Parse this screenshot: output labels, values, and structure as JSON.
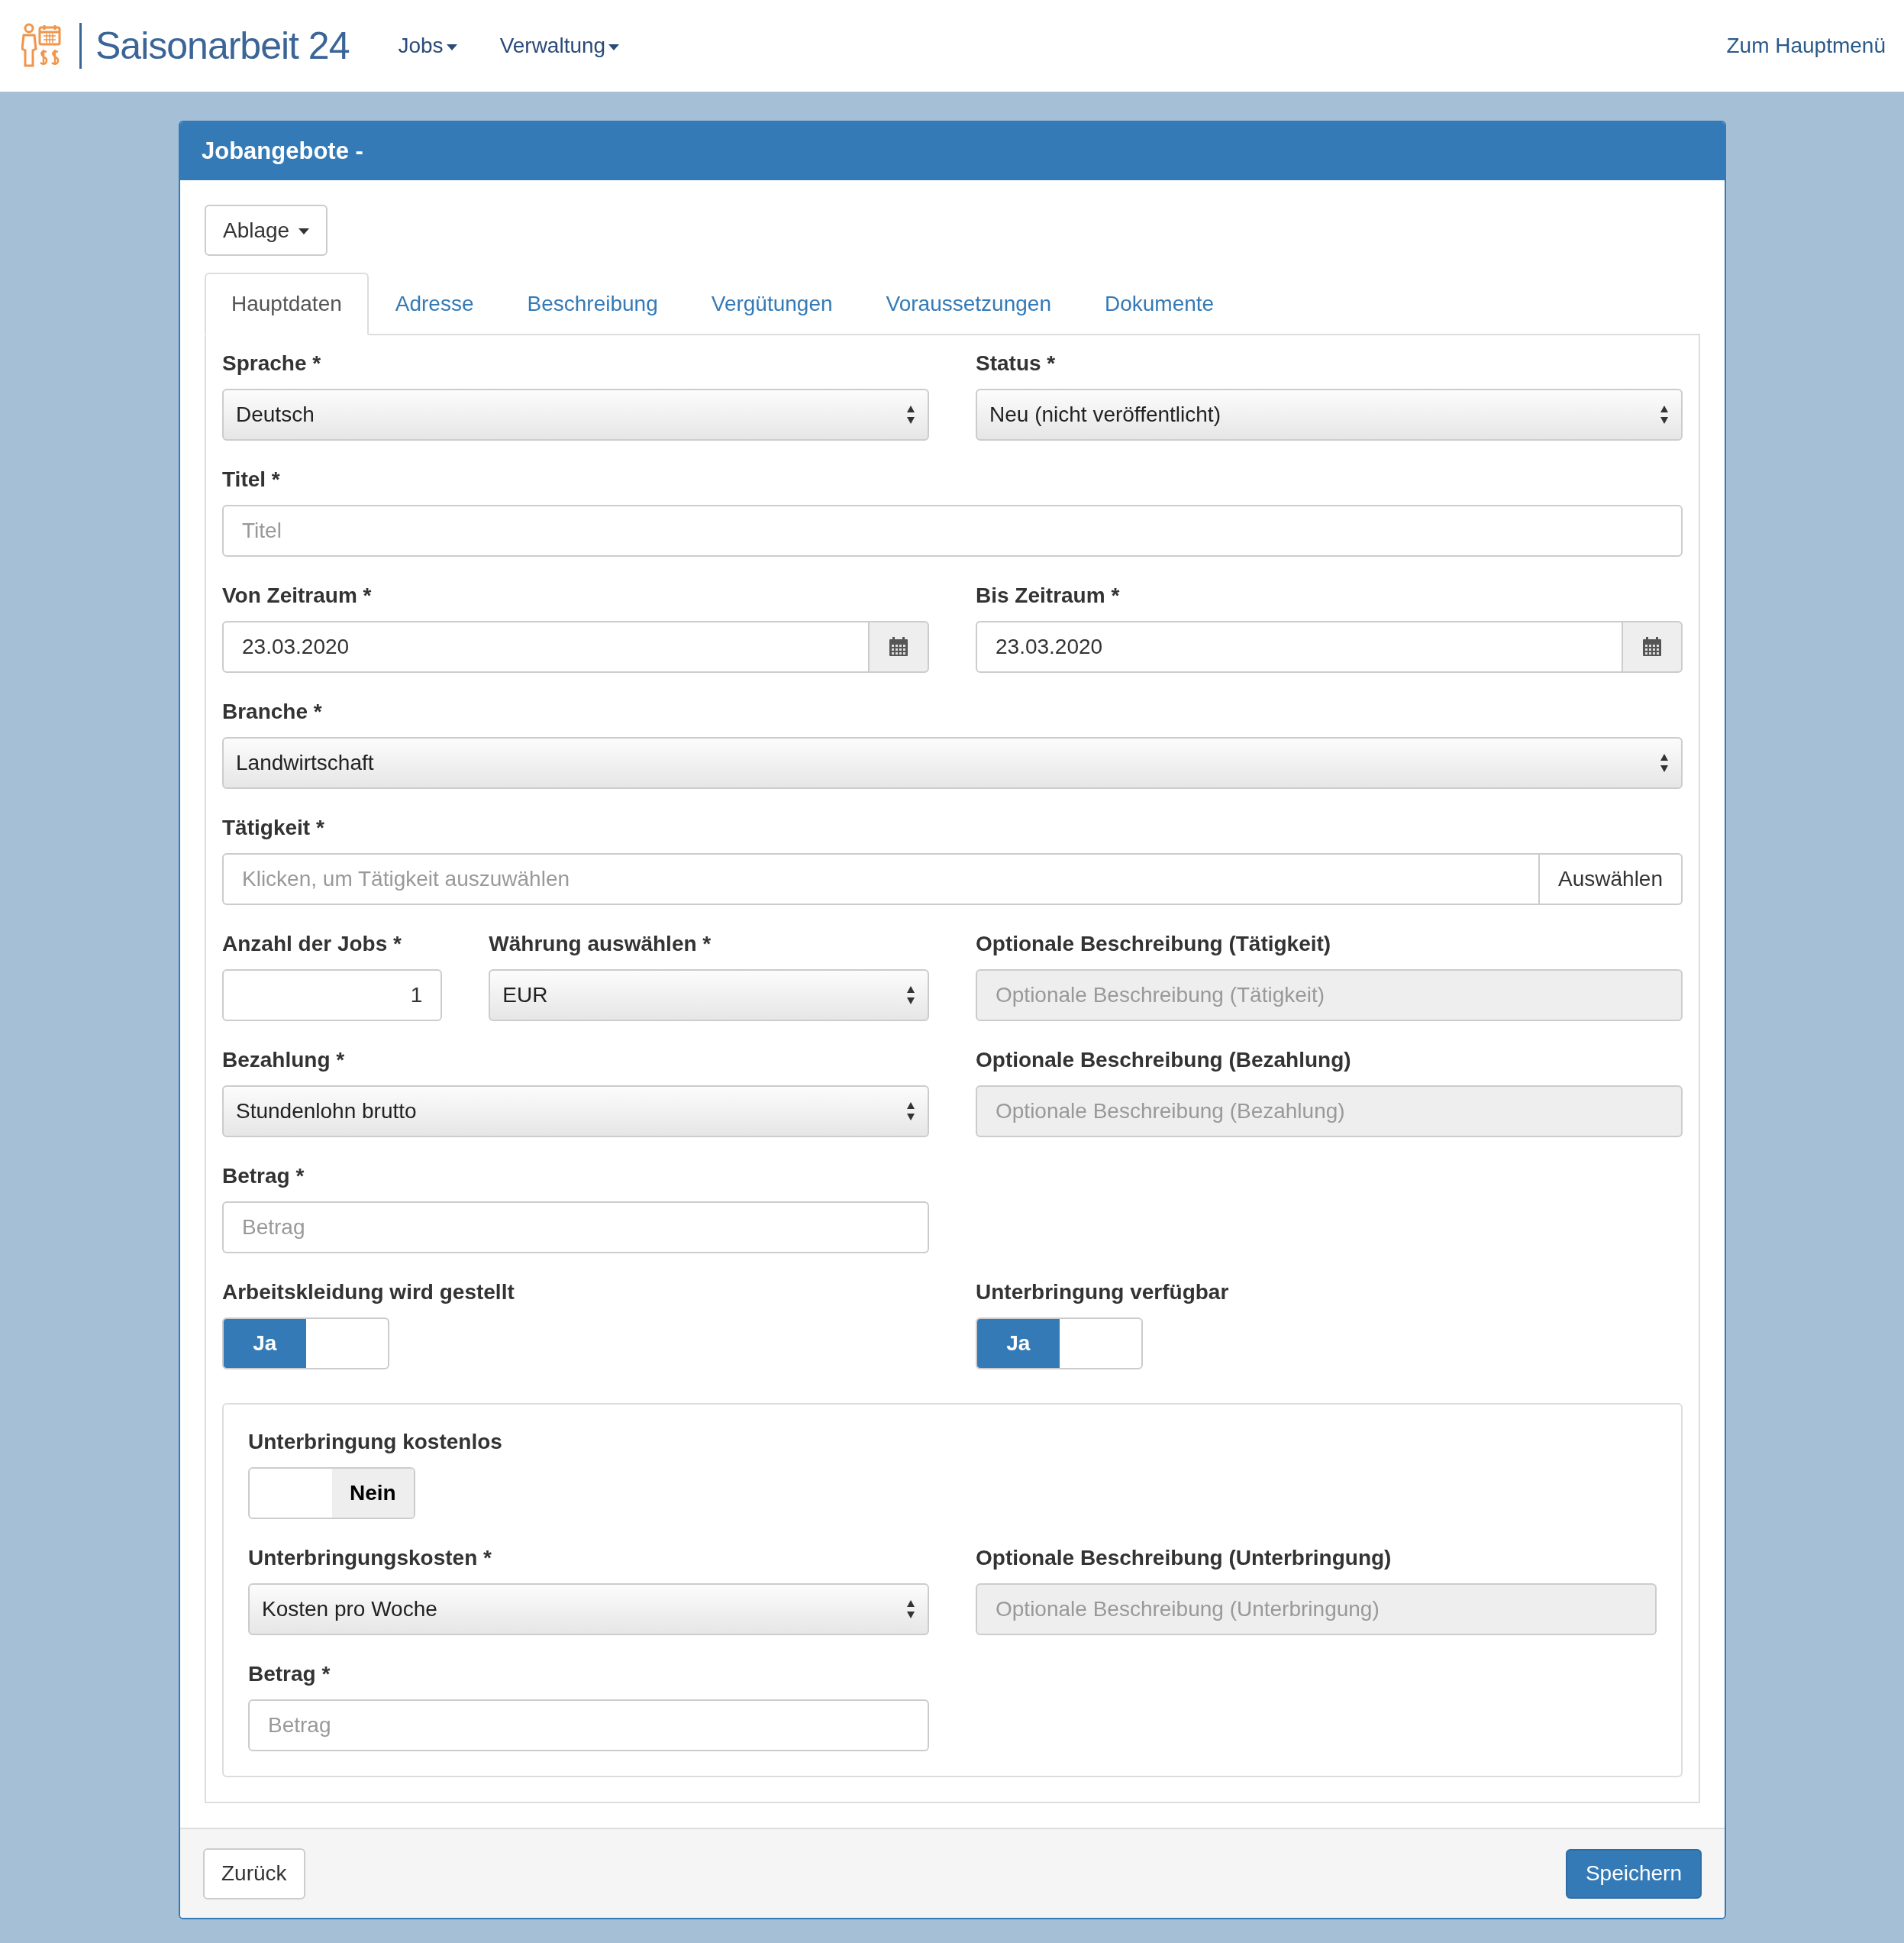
{
  "brand": {
    "name": "Saisonarbeit 24"
  },
  "nav": [
    {
      "label": "Jobs"
    },
    {
      "label": "Verwaltung"
    }
  ],
  "nav_right": "Zum Hauptmenü",
  "panel_title": "Jobangebote -",
  "file_menu": "Ablage",
  "tabs": [
    {
      "label": "Hauptdaten",
      "selected": true
    },
    {
      "label": "Adresse",
      "selected": false
    },
    {
      "label": "Beschreibung",
      "selected": false
    },
    {
      "label": "Vergütungen",
      "selected": false
    },
    {
      "label": "Voraussetzungen",
      "selected": false
    },
    {
      "label": "Dokumente",
      "selected": false
    }
  ],
  "rows": [
    {
      "kind": "fields",
      "fields": [
        {
          "kind": "select",
          "label": "Sprache *",
          "value": "Deutsch"
        },
        {
          "kind": "select",
          "label": "Status *",
          "value": "Neu (nicht veröffentlicht)"
        }
      ]
    },
    {
      "kind": "fields",
      "fields": [
        {
          "kind": "text",
          "label": "Titel *",
          "placeholder": "Titel",
          "disabled": false,
          "wide": true
        }
      ]
    },
    {
      "kind": "fields",
      "fields": [
        {
          "kind": "date",
          "label": "Von Zeitraum *",
          "value": "23.03.2020"
        },
        {
          "kind": "date",
          "label": "Bis Zeitraum *",
          "value": "23.03.2020"
        }
      ]
    },
    {
      "kind": "fields",
      "fields": [
        {
          "kind": "select",
          "label": "Branche *",
          "value": "Landwirtschaft",
          "wide": true
        }
      ]
    },
    {
      "kind": "fields",
      "fields": [
        {
          "kind": "picker",
          "label": "Tätigkeit *",
          "placeholder": "Klicken, um Tätigkeit auszuwählen",
          "button": "Auswählen",
          "wide": true
        }
      ]
    },
    {
      "kind": "fields",
      "fields": [
        {
          "kind": "number",
          "label": "Anzahl der Jobs *",
          "value": "1"
        },
        {
          "kind": "select",
          "label": "Währung auswählen *",
          "value": "EUR"
        },
        {
          "kind": "text",
          "label": "Optionale Beschreibung (Tätigkeit)",
          "placeholder": "Optionale Beschreibung (Tätigkeit)",
          "disabled": true
        }
      ]
    },
    {
      "kind": "fields",
      "fields": [
        {
          "kind": "select",
          "label": "Bezahlung *",
          "value": "Stundenlohn brutto"
        },
        {
          "kind": "text",
          "label": "Optionale Beschreibung (Bezahlung)",
          "placeholder": "Optionale Beschreibung (Bezahlung)",
          "disabled": true
        }
      ]
    },
    {
      "kind": "fields",
      "fields": [
        {
          "kind": "text",
          "label": "Betrag *",
          "placeholder": "Betrag",
          "disabled": false,
          "wide": false
        }
      ]
    },
    {
      "kind": "fields",
      "fields": [
        {
          "kind": "toggle",
          "label": "Arbeitskleidung wird gestellt",
          "on": true,
          "text": "Ja"
        },
        {
          "kind": "toggle",
          "label": "Unterbringung verfügbar",
          "on": true,
          "text": "Ja"
        }
      ]
    },
    {
      "kind": "group",
      "rows": [
        {
          "kind": "fields",
          "fields": [
            {
              "kind": "toggle",
              "label": "Unterbringung kostenlos",
              "on": false,
              "text": "Nein"
            }
          ]
        },
        {
          "kind": "fields",
          "fields": [
            {
              "kind": "select",
              "label": "Unterbringungskosten *",
              "value": "Kosten pro Woche"
            },
            {
              "kind": "text",
              "label": "Optionale Beschreibung (Unterbringung)",
              "placeholder": "Optionale Beschreibung (Unterbringung)",
              "disabled": true
            }
          ]
        },
        {
          "kind": "fields",
          "fields": [
            {
              "kind": "text",
              "label": "Betrag *",
              "placeholder": "Betrag",
              "disabled": false,
              "wide": false
            }
          ]
        }
      ]
    }
  ],
  "footer": {
    "back": "Zurück",
    "save": "Speichern"
  }
}
